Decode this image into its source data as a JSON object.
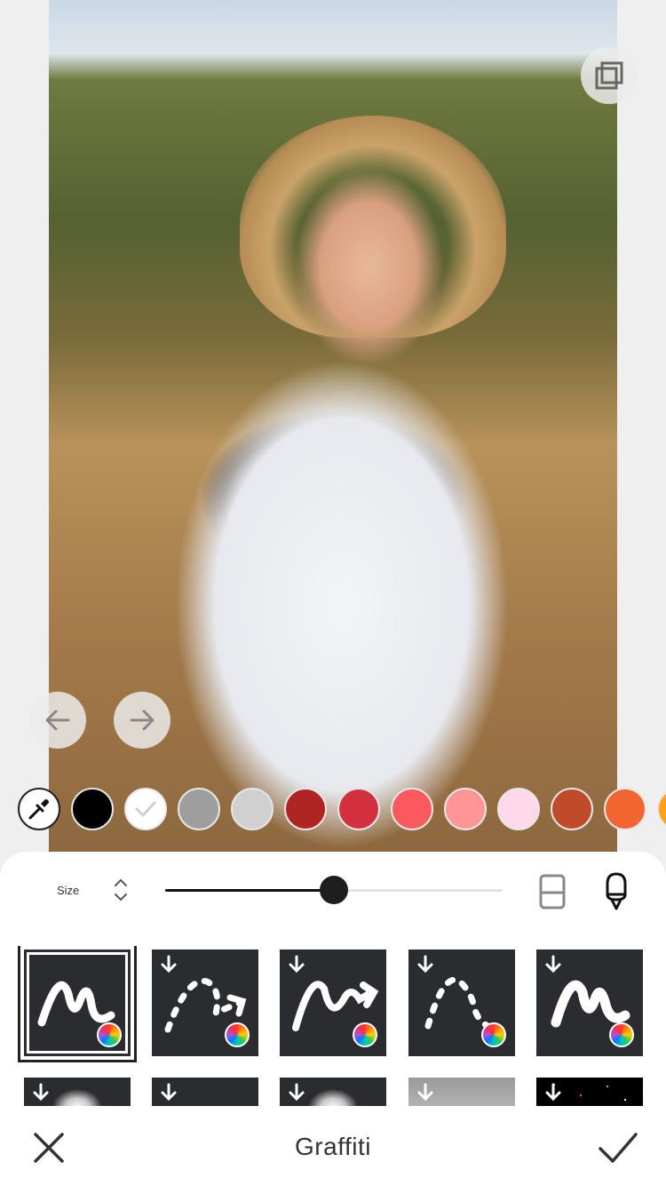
{
  "photo": {
    "subject": "woman-holding-chicken-photo"
  },
  "controls": {
    "compare_icon": "compare-layers-icon",
    "undo_icon": "arrow-left-icon",
    "redo_icon": "arrow-right-icon"
  },
  "colors": {
    "picker_icon": "eyedropper-icon",
    "swatches": [
      "#000000",
      "#ffffff",
      "#9e9e9e",
      "#d0d0d0",
      "#b02422",
      "#d43140",
      "#fa5a5e",
      "#ff9595",
      "#ffd9ea",
      "#c14a2b",
      "#f26430",
      "#ff9f1a"
    ],
    "selected_index": 1
  },
  "size": {
    "label": "Size",
    "value_fraction": 0.5
  },
  "tools": {
    "eraser_icon": "eraser-icon",
    "brush_icon": "brush-icon"
  },
  "bottom_bar": {
    "title": "Graffiti",
    "cancel_icon": "close-icon",
    "confirm_icon": "checkmark-icon"
  }
}
